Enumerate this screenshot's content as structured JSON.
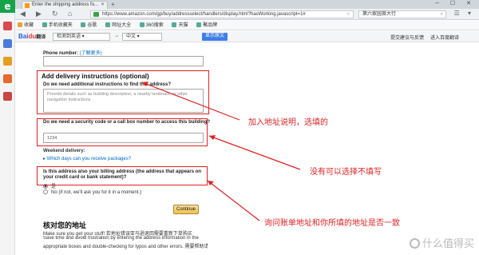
{
  "browser": {
    "sidebar_logo": "e",
    "tab": {
      "title": "Enter the shipping address fo..."
    },
    "nav": {
      "back": "◀",
      "forward": "▶",
      "refresh": "↻",
      "home": "⌂"
    },
    "address_bar": {
      "url": "https://www.amazon.com/gp/buy/addressselect/handlers/display.html?hasWorking.javascript=1#"
    },
    "search_box": {
      "value": "第六家园首大行"
    },
    "bookmarks": [
      "收藏",
      "手机收藏夹",
      "谷歌",
      "网址大全",
      "360搜索",
      "天猫",
      "聚品牌"
    ],
    "translate_bar": {
      "logo_main": "Bai",
      "logo_accent": "du",
      "logo_suffix": "翻译",
      "from": "检测到英语 ▾",
      "arrow": "→",
      "to": "中文 ▾",
      "button": "显示原文",
      "feedback": "提交建议与反馈",
      "open": "进入百度翻译"
    }
  },
  "page": {
    "phone_label": "Phone number:",
    "phone_hint": "(了解更多)",
    "section_title": "Add delivery instructions (optional)",
    "instructions_label": "Do we need additional instructions to find this address?",
    "instructions_placeholder": "Provide details such as building description, a nearby landmark, or other navigation instructions",
    "security_label": "Do we need a security code or a call box number to access this building?",
    "security_value": "1234",
    "weekend_label": "Weekend delivery:",
    "weekend_link": "▸ Which days can you receive packages?",
    "billing_question": "Is this address also your billing address (the address that appears on your credit card or bank statement)?",
    "billing_options": [
      {
        "label": "是",
        "selected": true
      },
      {
        "label": "No (if not, we'll ask you for it in a moment.)",
        "selected": false
      }
    ],
    "continue_button": "Continue",
    "verify_heading": "核对您的地址",
    "verify_text": [
      "Make sure you get your stuff! 若地址错误亚马逊退回需要重新下单购买",
      "Save time and avoid frustration by entering the address information in the",
      "appropriate boxes and double-checking for typos and other errors. 需要帮助请点"
    ]
  },
  "annotations": [
    "加入地址说明，选填的",
    "没有可以选择不填写",
    "询问账单地址和你所填的地址是否一致"
  ],
  "watermark": "什么值得买",
  "colors": {
    "annotation": "#dd2222",
    "link": "#0066c0",
    "continue_button": "#f0c14b"
  }
}
